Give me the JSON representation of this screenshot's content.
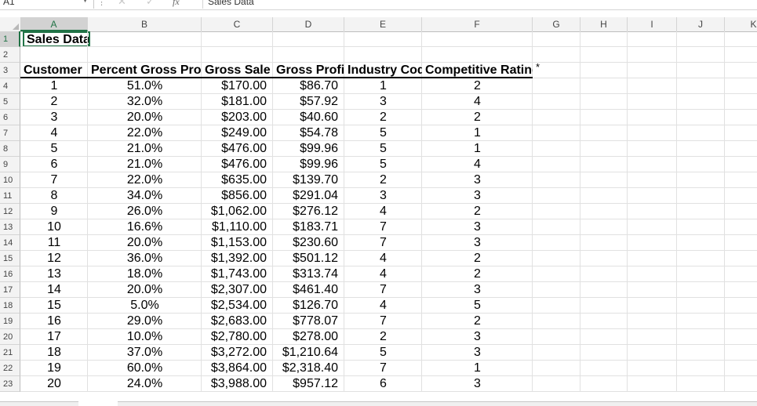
{
  "formula_bar": {
    "name_box": "A1",
    "content": "Sales Data",
    "fx": "fx"
  },
  "columns": [
    "A",
    "B",
    "C",
    "D",
    "E",
    "F",
    "G",
    "H",
    "I",
    "J",
    "K"
  ],
  "selected_column": "A",
  "selected_row": "1",
  "rows": [
    "1",
    "2",
    "3",
    "4",
    "5",
    "6",
    "7",
    "8",
    "9",
    "10",
    "11",
    "12",
    "13",
    "14",
    "15",
    "16",
    "17",
    "18",
    "19",
    "20",
    "21",
    "22",
    "23"
  ],
  "sheet": {
    "title": "Sales Data",
    "headers": {
      "a": "Customer",
      "b": "Percent Gross Pro",
      "c": "Gross Sale",
      "d": "Gross Profi",
      "e": "Industry Cod",
      "f": "Competitive Rating",
      "f_overflow": "*"
    },
    "data": [
      [
        "1",
        "51.0%",
        "$170.00",
        "$86.70",
        "1",
        "2"
      ],
      [
        "2",
        "32.0%",
        "$181.00",
        "$57.92",
        "3",
        "4"
      ],
      [
        "3",
        "20.0%",
        "$203.00",
        "$40.60",
        "2",
        "2"
      ],
      [
        "4",
        "22.0%",
        "$249.00",
        "$54.78",
        "5",
        "1"
      ],
      [
        "5",
        "21.0%",
        "$476.00",
        "$99.96",
        "5",
        "1"
      ],
      [
        "6",
        "21.0%",
        "$476.00",
        "$99.96",
        "5",
        "4"
      ],
      [
        "7",
        "22.0%",
        "$635.00",
        "$139.70",
        "2",
        "3"
      ],
      [
        "8",
        "34.0%",
        "$856.00",
        "$291.04",
        "3",
        "3"
      ],
      [
        "9",
        "26.0%",
        "$1,062.00",
        "$276.12",
        "4",
        "2"
      ],
      [
        "10",
        "16.6%",
        "$1,110.00",
        "$183.71",
        "7",
        "3"
      ],
      [
        "11",
        "20.0%",
        "$1,153.00",
        "$230.60",
        "7",
        "3"
      ],
      [
        "12",
        "36.0%",
        "$1,392.00",
        "$501.12",
        "4",
        "2"
      ],
      [
        "13",
        "18.0%",
        "$1,743.00",
        "$313.74",
        "4",
        "2"
      ],
      [
        "14",
        "20.0%",
        "$2,307.00",
        "$461.40",
        "7",
        "3"
      ],
      [
        "15",
        "5.0%",
        "$2,534.00",
        "$126.70",
        "4",
        "5"
      ],
      [
        "16",
        "29.0%",
        "$2,683.00",
        "$778.07",
        "7",
        "2"
      ],
      [
        "17",
        "10.0%",
        "$2,780.00",
        "$278.00",
        "2",
        "3"
      ],
      [
        "18",
        "37.0%",
        "$3,272.00",
        "$1,210.64",
        "5",
        "3"
      ],
      [
        "19",
        "60.0%",
        "$3,864.00",
        "$2,318.40",
        "7",
        "1"
      ],
      [
        "20",
        "24.0%",
        "$3,988.00",
        "$957.12",
        "6",
        "3"
      ]
    ]
  },
  "colors": {
    "accent": "#217346",
    "grid": "#e1e1e1",
    "header_bg": "#f3f3f3"
  }
}
